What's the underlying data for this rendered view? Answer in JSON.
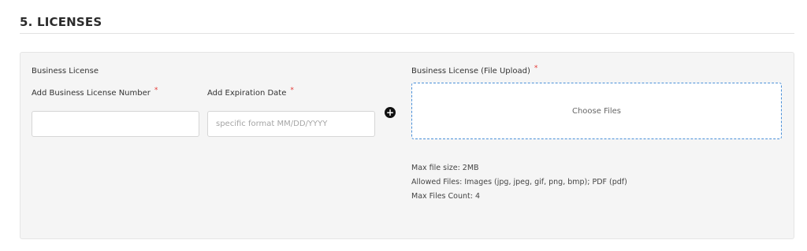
{
  "section": {
    "title": "5. LICENSES"
  },
  "licenses": {
    "group_label": "Business License",
    "number_label": "Add Business License Number",
    "number_value": "",
    "number_placeholder": "",
    "date_label": "Add Expiration Date",
    "date_placeholder": "specific format MM/DD/YYYY",
    "required_mark": "*",
    "add_icon": "plus-circle-icon",
    "upload_label": "Business License (File Upload)",
    "upload_button": "Choose Files",
    "notes": {
      "max_size": "Max file size: 2MB",
      "allowed": "Allowed Files: Images (jpg, jpeg, gif, png, bmp); PDF (pdf)",
      "max_count": "Max Files Count: 4"
    }
  },
  "colors": {
    "required": "#e53935",
    "dropzone_border": "#4a90d9",
    "card_background": "#f5f5f5"
  }
}
